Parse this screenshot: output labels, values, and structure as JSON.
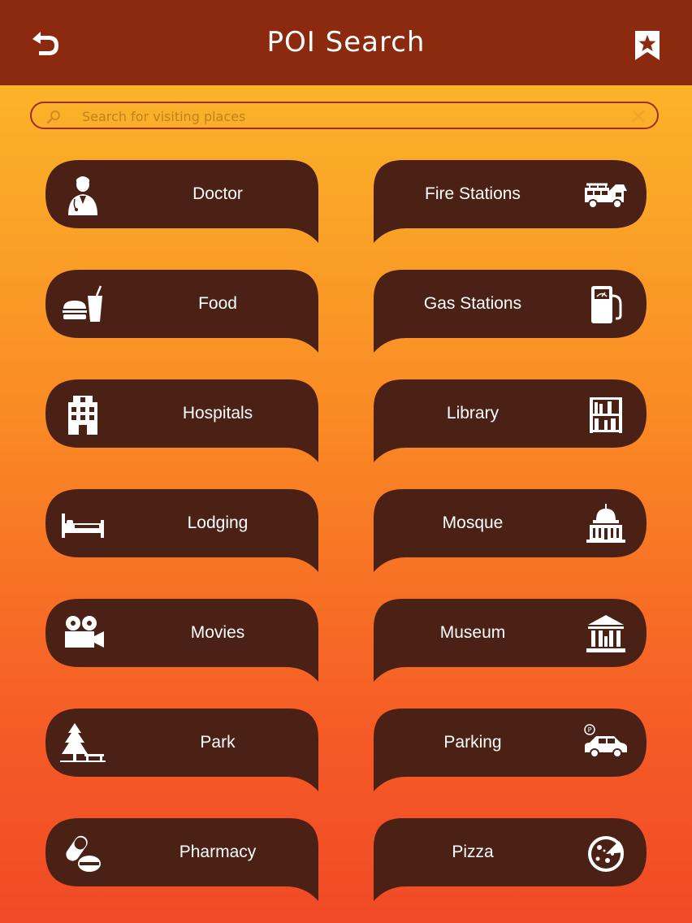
{
  "header": {
    "title": "POI Search",
    "back_icon": "back-arrow-icon",
    "bookmark_icon": "bookmark-star-icon"
  },
  "search": {
    "placeholder": "Search for visiting places",
    "value": ""
  },
  "colors": {
    "header_bg": "#8C2A10",
    "tile_bg": "#4A2114",
    "gradient_top": "#FBBE2B",
    "gradient_bottom": "#F04A26"
  },
  "categories": [
    {
      "label": "Doctor",
      "icon": "doctor-icon"
    },
    {
      "label": "Fire Stations",
      "icon": "fire-truck-icon"
    },
    {
      "label": "Food",
      "icon": "burger-drink-icon"
    },
    {
      "label": "Gas Stations",
      "icon": "gas-pump-icon"
    },
    {
      "label": "Hospitals",
      "icon": "hospital-building-icon"
    },
    {
      "label": "Library",
      "icon": "bookshelf-icon"
    },
    {
      "label": "Lodging",
      "icon": "bed-icon"
    },
    {
      "label": "Mosque",
      "icon": "dome-building-icon"
    },
    {
      "label": "Movies",
      "icon": "film-camera-icon"
    },
    {
      "label": "Museum",
      "icon": "museum-building-icon"
    },
    {
      "label": "Park",
      "icon": "tree-bench-icon"
    },
    {
      "label": "Parking",
      "icon": "parking-car-icon"
    },
    {
      "label": "Pharmacy",
      "icon": "pills-icon"
    },
    {
      "label": "Pizza",
      "icon": "pizza-icon"
    }
  ]
}
